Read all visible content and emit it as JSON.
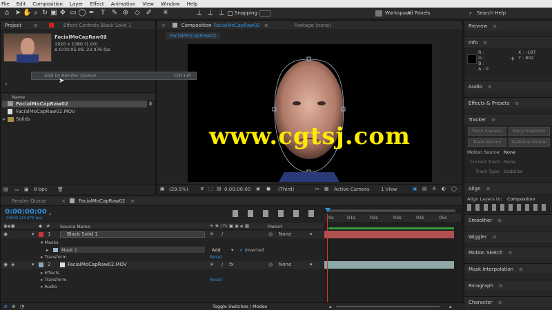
{
  "menu": [
    "File",
    "Edit",
    "Composition",
    "Layer",
    "Effect",
    "Animation",
    "View",
    "Window",
    "Help"
  ],
  "toolbar": {
    "snapping": "Snapping",
    "workspace_label": "Workspace:",
    "workspace_value": "All Panels",
    "search_help": "Search Help"
  },
  "project": {
    "tab": "Project",
    "effect_controls_tab": "Effect Controls Black Solid 1",
    "item_name": "FacialMoCapRaw02",
    "item_res": "1920 x 1080 (1.00)",
    "item_dur": "Δ 0:00:05:09, 23.976 fps",
    "context_menu": "Add to Render Queue",
    "context_shortcut": "Ctrl+M",
    "col_name": "Name",
    "items": [
      {
        "name": "FacialMoCapRaw02",
        "selected": true
      },
      {
        "name": "FacialMoCapRaw02.MOV",
        "selected": false
      },
      {
        "name": "Solids",
        "selected": false
      }
    ],
    "bpc": "8 bpc"
  },
  "comp": {
    "tab": "Composition",
    "tab_comp_name": "FacialMoCapRaw02",
    "footage_tab": "Footage (none)",
    "sub_tab": "FacialMoCapRaw02",
    "watermark": "www.cgtsj.com",
    "zoom": "(29.5%)",
    "time": "0:00:00:00",
    "res": "(Third)",
    "camera": "Active Camera",
    "view": "1 View"
  },
  "right": {
    "preview": "Preview",
    "info": "Info",
    "info_r": "R :",
    "info_g": "G :",
    "info_b": "B :",
    "info_a": "A : 0",
    "info_x": "X : -187",
    "info_y": "Y : 802",
    "audio": "Audio",
    "effects": "Effects & Presets",
    "tracker": "Tracker",
    "track_camera": "Track Camera",
    "warp_stabilizer": "Warp Stabilizer",
    "track_motion": "Track Motion",
    "stabilize_motion": "Stabilize Motion",
    "motion_source": "Motion Source:",
    "motion_source_val": "None",
    "current_track": "Current Track:",
    "current_track_val": "None",
    "track_type": "Track Type:",
    "track_type_val": "Stabilize",
    "align": "Align",
    "align_to": "Align Layers to:",
    "align_to_val": "Composition",
    "smoother": "Smoother",
    "wiggler": "Wiggler",
    "motion_sketch": "Motion Sketch",
    "mask_interp": "Mask Interpolation",
    "paragraph": "Paragraph",
    "character": "Character"
  },
  "timeline": {
    "render_queue": "Render Queue",
    "comp_tab": "FacialMoCapRaw02",
    "timecode": "0:00:00:00",
    "frames": "00000 (23.976 fps)",
    "col_source": "Source Name",
    "col_parent": "Parent",
    "ruler": [
      "0s",
      "01s",
      "02s",
      "03s",
      "04s",
      "05s"
    ],
    "layers": [
      {
        "num": "1",
        "name": "Black Solid 1",
        "parent": "None"
      },
      {
        "num": "2",
        "name": "FacialMoCapRaw02.MOV",
        "parent": "None"
      }
    ],
    "masks": "Masks",
    "mask1": "Mask 1",
    "mask_mode": "Add",
    "inverted": "Inverted",
    "transform": "Transform",
    "reset": "Reset",
    "effects": "Effects",
    "audio": "Audio",
    "toggle": "Toggle Switches / Modes"
  }
}
